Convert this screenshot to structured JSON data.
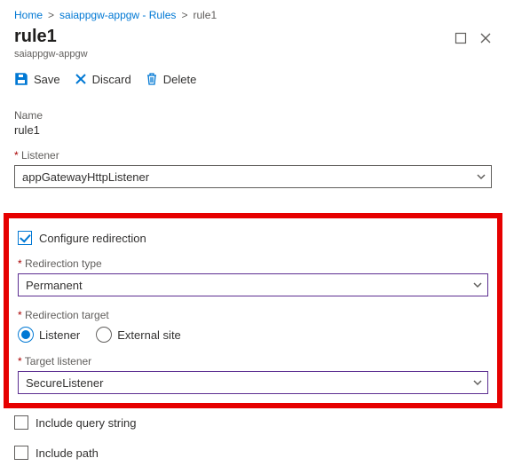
{
  "breadcrumb": {
    "home": "Home",
    "parent": "saiappgw-appgw - Rules",
    "current": "rule1"
  },
  "header": {
    "title": "rule1",
    "subtitle": "saiappgw-appgw"
  },
  "toolbar": {
    "save_label": "Save",
    "discard_label": "Discard",
    "delete_label": "Delete"
  },
  "form": {
    "name_label": "Name",
    "name_value": "rule1",
    "listener_label": "Listener",
    "listener_value": "appGatewayHttpListener",
    "configure_redirection_label": "Configure redirection",
    "redirection_type_label": "Redirection type",
    "redirection_type_value": "Permanent",
    "redirection_target_label": "Redirection target",
    "target_option_listener": "Listener",
    "target_option_external": "External site",
    "target_listener_label": "Target listener",
    "target_listener_value": "SecureListener",
    "include_query_label": "Include query string",
    "include_path_label": "Include path"
  }
}
